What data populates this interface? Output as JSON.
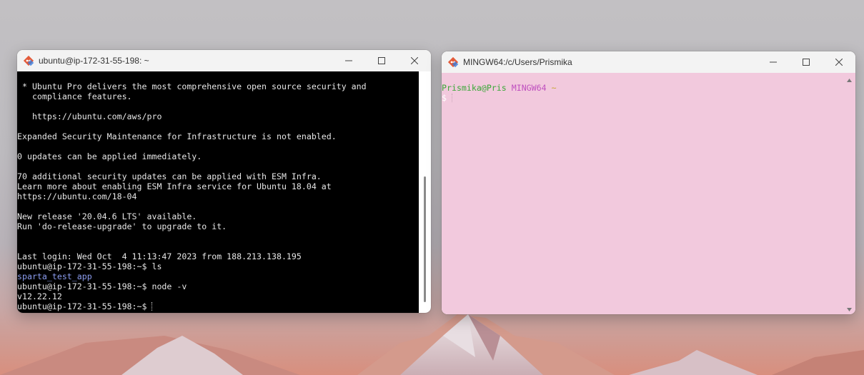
{
  "left_window": {
    "title": "ubuntu@ip-172-31-55-198: ~",
    "lines": [
      "",
      " * Ubuntu Pro delivers the most comprehensive open source security and",
      "   compliance features.",
      "",
      "   https://ubuntu.com/aws/pro",
      "",
      "Expanded Security Maintenance for Infrastructure is not enabled.",
      "",
      "0 updates can be applied immediately.",
      "",
      "70 additional security updates can be applied with ESM Infra.",
      "Learn more about enabling ESM Infra service for Ubuntu 18.04 at",
      "https://ubuntu.com/18-04",
      "",
      "New release '20.04.6 LTS' available.",
      "Run 'do-release-upgrade' to upgrade to it.",
      "",
      "",
      "Last login: Wed Oct  4 11:13:47 2023 from 188.213.138.195",
      "ubuntu@ip-172-31-55-198:~$ ls"
    ],
    "ls_output": "sparta_test_app",
    "cmd_node": "ubuntu@ip-172-31-55-198:~$ node -v",
    "node_version": "v12.22.12",
    "final_prompt": "ubuntu@ip-172-31-55-198:~$ "
  },
  "right_window": {
    "title": "MINGW64:/c/Users/Prismika",
    "prompt_user": "Prismika@Pris",
    "prompt_env": "MINGW64",
    "prompt_dir": "~",
    "prompt_symbol": "$"
  },
  "icons": {
    "app": "git-icon",
    "minimize": "minimize-icon",
    "maximize": "maximize-icon",
    "close": "close-icon"
  },
  "colors": {
    "terminal_left_bg": "#000000",
    "terminal_right_bg": "#f2c9dd",
    "ls_blue": "#8c9df0",
    "mingw_green": "#3aa838",
    "mingw_magenta": "#bf50bf",
    "mingw_yellow": "#c7a634"
  }
}
